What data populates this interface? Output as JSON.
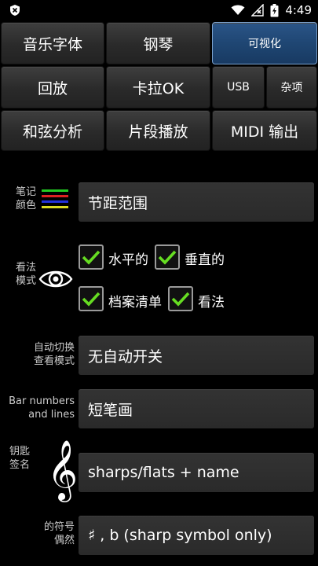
{
  "status": {
    "time": "4:49",
    "icons": [
      "shield-icon",
      "wifi-icon",
      "no-signal-icon",
      "battery-icon"
    ]
  },
  "tabs": {
    "music_font": "音乐字体",
    "piano": "钢琴",
    "visualize": "可视化",
    "playback": "回放",
    "karaoke": "卡拉OK",
    "usb": "USB",
    "misc": "杂项",
    "chord_analysis": "和弦分析",
    "segment_play": "片段播放",
    "midi_output": "MIDI 输出"
  },
  "settings": {
    "note_color": {
      "label_line1": "笔记",
      "label_line2": "颜色",
      "value": "节距范围",
      "swatch_colors": [
        "#22cc22",
        "#dd2222",
        "#2233dd",
        "#dddd22"
      ]
    },
    "view_mode": {
      "label_line1": "看法",
      "label_line2": "模式",
      "options": [
        {
          "label": "水平的",
          "checked": true
        },
        {
          "label": "垂直的",
          "checked": true
        },
        {
          "label": "档案清单",
          "checked": true
        },
        {
          "label": "看法",
          "checked": true
        }
      ]
    },
    "auto_switch": {
      "label_line1": "自动切换",
      "label_line2": "查看模式",
      "value": "无自动开关"
    },
    "bar_numbers": {
      "label_line1": "Bar numbers",
      "label_line2": "and lines",
      "value": "短笔画"
    },
    "key_signature": {
      "label_line1": "钥匙",
      "label_line2": "签名",
      "value": "sharps/flats + name"
    },
    "accidentals": {
      "label_line1": "的符号",
      "label_line2": "偶然",
      "value": "♯ , b  (sharp symbol only)"
    }
  },
  "colors": {
    "active_tab": "#1f4673",
    "checkmark": "#66dd22",
    "background": "#000000"
  }
}
